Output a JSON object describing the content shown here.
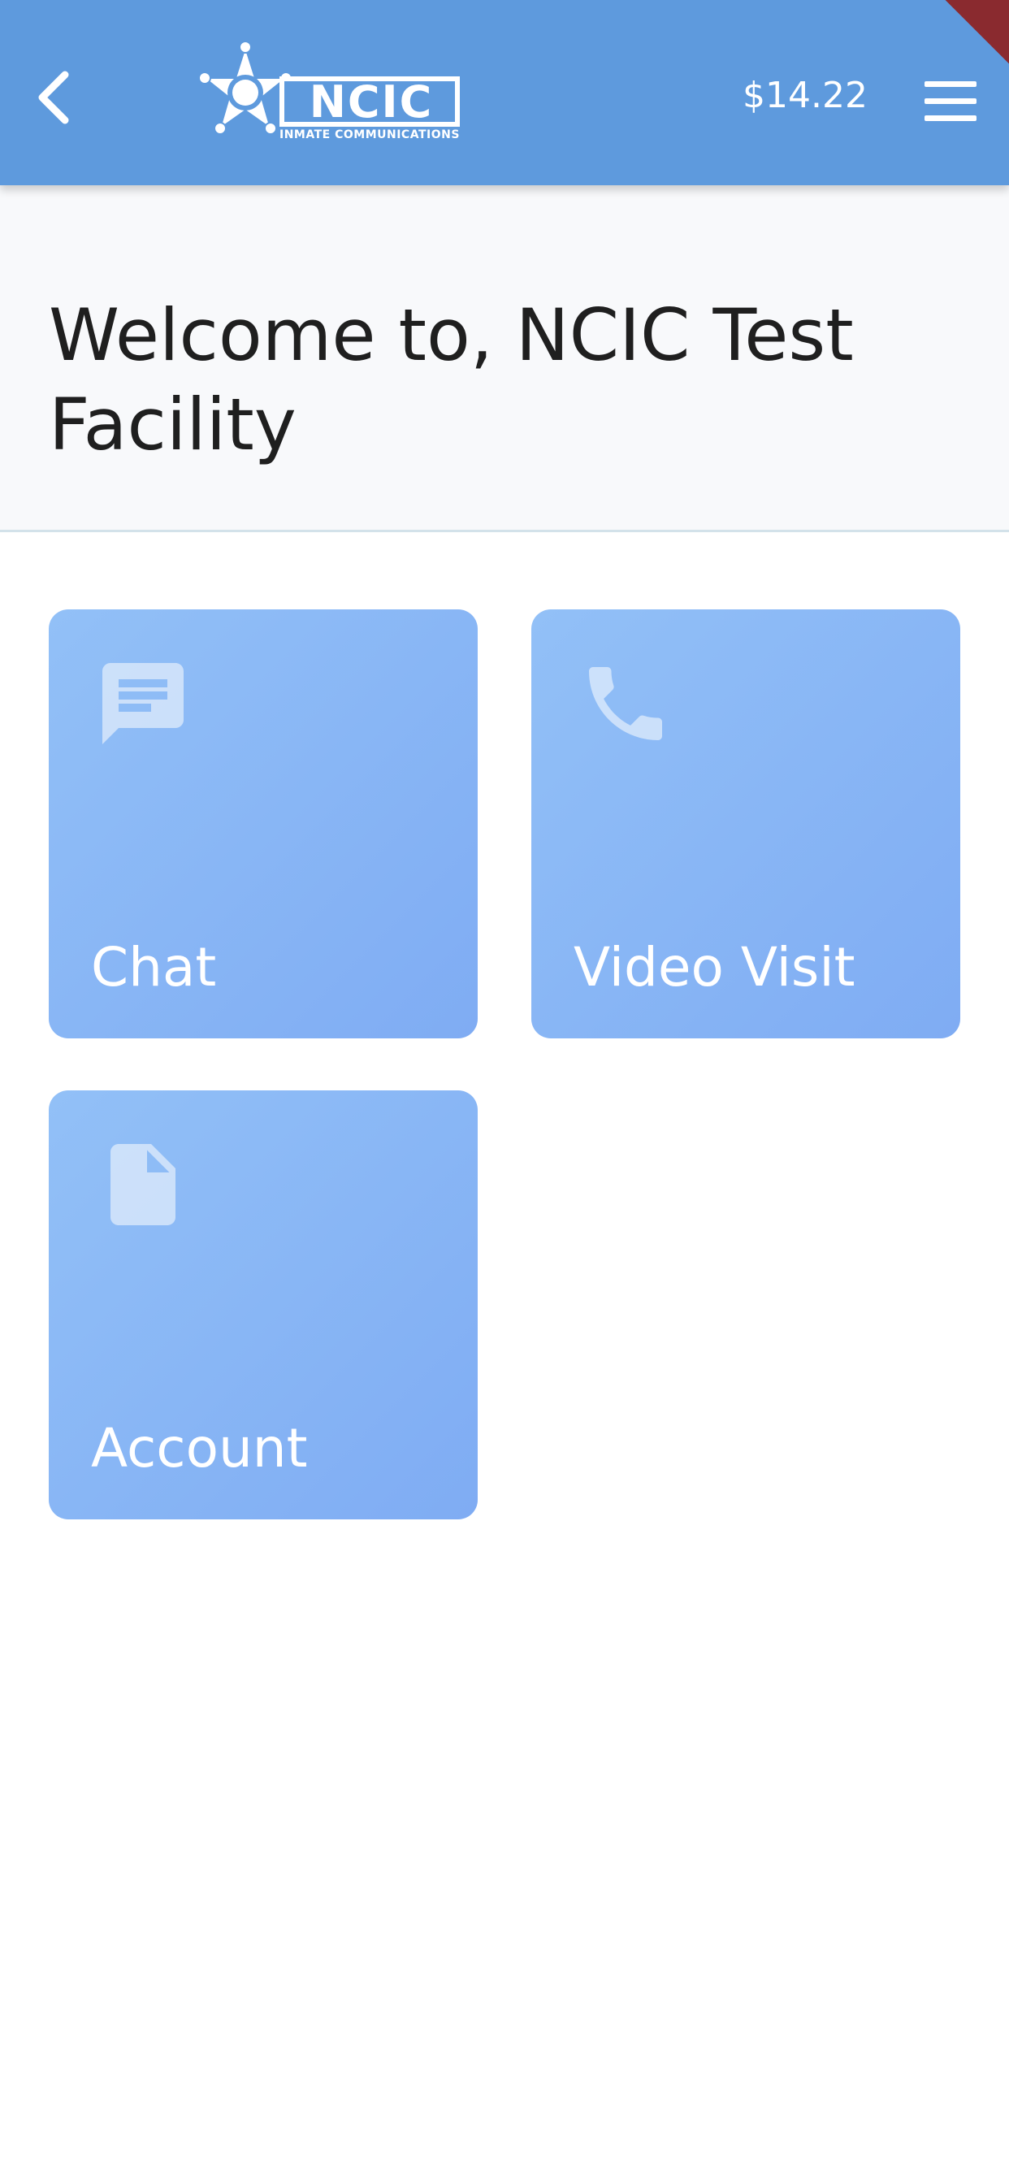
{
  "header": {
    "back_icon": "chevron-left-icon",
    "logo_text": "NCIC",
    "logo_subtext": "INMATE COMMUNICATIONS",
    "balance": "$14.22",
    "menu_icon": "hamburger-menu-icon",
    "bar_color": "#5e9add"
  },
  "welcome": {
    "title": "Welcome to, NCIC Test Facility"
  },
  "tiles": [
    {
      "label": "Chat",
      "icon": "chat-icon"
    },
    {
      "label": "Video Visit",
      "icon": "phone-icon"
    },
    {
      "label": "Account",
      "icon": "document-icon"
    }
  ],
  "colors": {
    "tile_gradient_start": "#92c0f7",
    "tile_gradient_end": "#7facf3",
    "welcome_bg": "#f8f9fb",
    "debug_banner": "#8a2a2f"
  }
}
